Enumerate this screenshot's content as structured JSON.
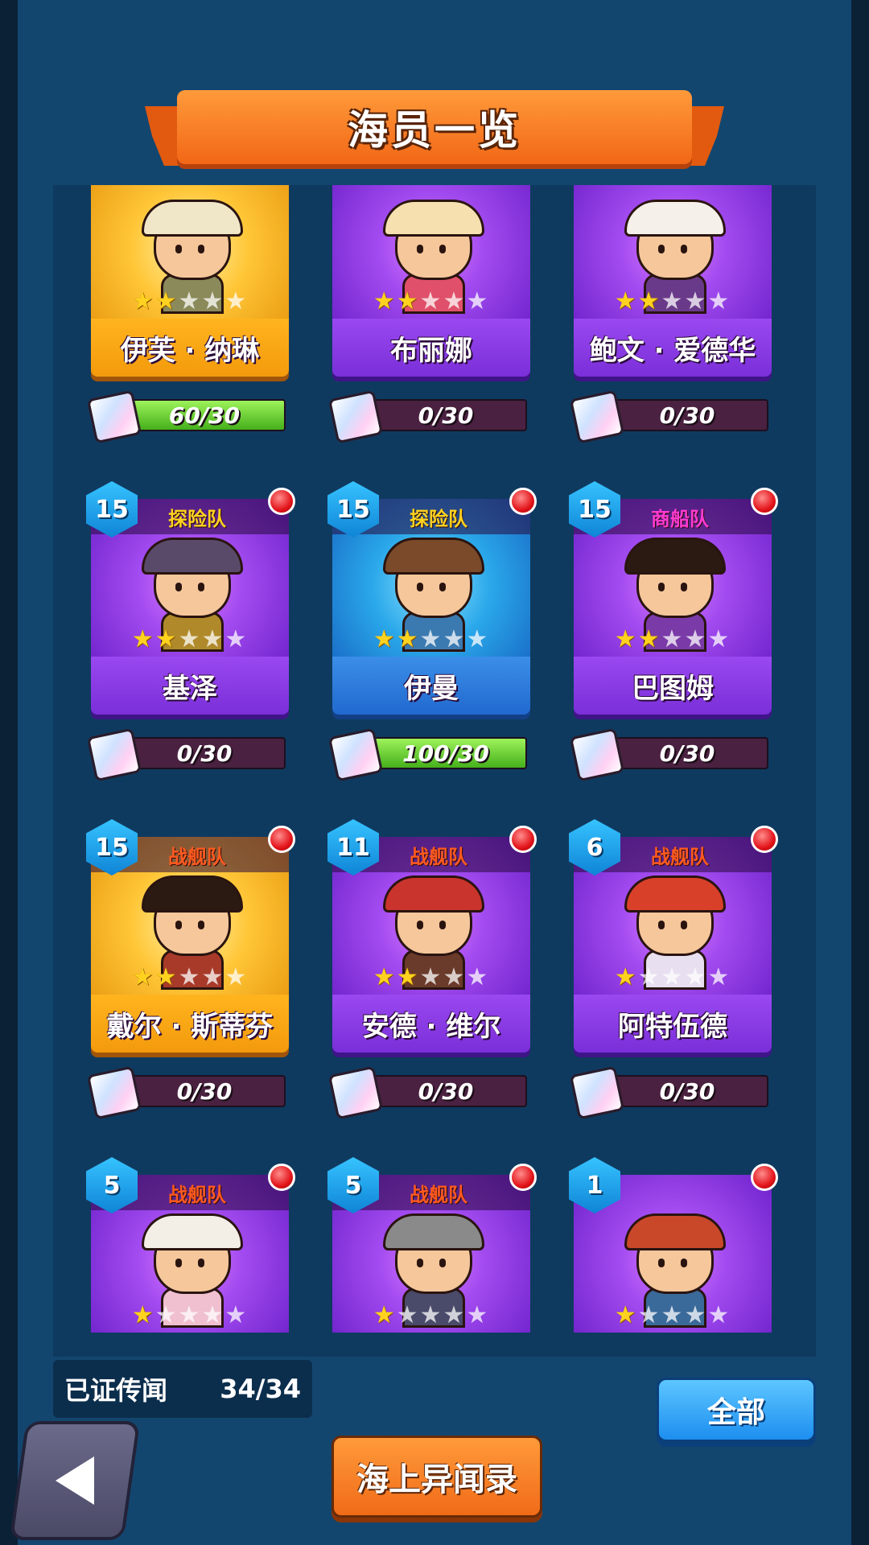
{
  "title": "海员一览",
  "colors": {
    "gold_card": "#ffc637",
    "purple_card": "#a24bf0",
    "blue_card": "#2aa8ea",
    "team_orange": "#ff5a1f",
    "team_yellow": "#ffd21f",
    "team_pink": "#ff3bd1",
    "progress_fill": "#45b01b"
  },
  "crew": [
    {
      "name": "伊芙 · 纳琳",
      "rarity": "gold",
      "level": "",
      "team": "",
      "stars": 2,
      "progress": "60/30",
      "progress_fraction": 1.0,
      "red_dot": false
    },
    {
      "name": "布丽娜",
      "rarity": "purple",
      "level": "",
      "team": "",
      "stars": 2,
      "progress": "0/30",
      "progress_fraction": 0,
      "red_dot": false
    },
    {
      "name": "鲍文 · 爱德华",
      "rarity": "purple",
      "level": "",
      "team": "",
      "stars": 2,
      "progress": "0/30",
      "progress_fraction": 0,
      "red_dot": false
    },
    {
      "name": "基泽",
      "rarity": "purple",
      "level": "15",
      "team": "探险队",
      "team_color": "#ffd21f",
      "stars": 2,
      "progress": "0/30",
      "progress_fraction": 0,
      "red_dot": true
    },
    {
      "name": "伊曼",
      "rarity": "blue",
      "level": "15",
      "team": "探险队",
      "team_color": "#ffd21f",
      "stars": 2,
      "progress": "100/30",
      "progress_fraction": 1.0,
      "red_dot": true
    },
    {
      "name": "巴图姆",
      "rarity": "purple",
      "level": "15",
      "team": "商船队",
      "team_color": "#ff3bd1",
      "stars": 2,
      "progress": "0/30",
      "progress_fraction": 0,
      "red_dot": true
    },
    {
      "name": "戴尔 · 斯蒂芬",
      "rarity": "gold",
      "level": "15",
      "team": "战舰队",
      "team_color": "#ff5a1f",
      "stars": 2,
      "progress": "0/30",
      "progress_fraction": 0,
      "red_dot": true
    },
    {
      "name": "安德 · 维尔",
      "rarity": "purple",
      "level": "11",
      "team": "战舰队",
      "team_color": "#ff5a1f",
      "stars": 2,
      "progress": "0/30",
      "progress_fraction": 0,
      "red_dot": true
    },
    {
      "name": "阿特伍德",
      "rarity": "purple",
      "level": "6",
      "team": "战舰队",
      "team_color": "#ff5a1f",
      "stars": 1,
      "progress": "0/30",
      "progress_fraction": 0,
      "red_dot": true
    },
    {
      "name": "",
      "rarity": "purple",
      "level": "5",
      "team": "战舰队",
      "team_color": "#ff5a1f",
      "stars": 1,
      "progress": "",
      "progress_fraction": 0,
      "red_dot": true
    },
    {
      "name": "",
      "rarity": "purple",
      "level": "5",
      "team": "战舰队",
      "team_color": "#ff5a1f",
      "stars": 1,
      "progress": "",
      "progress_fraction": 0,
      "red_dot": true
    },
    {
      "name": "",
      "rarity": "purple",
      "level": "1",
      "team": "",
      "team_color": "#ff5a1f",
      "stars": 1,
      "progress": "",
      "progress_fraction": 0,
      "red_dot": true
    }
  ],
  "footer": {
    "legend_label": "已证传闻",
    "legend_count": "34/34",
    "all_button": "全部",
    "rumor_button": "海上异闻录",
    "back_icon": "back-arrow-icon",
    "puzzle_icon": "puzzle-piece-icon"
  }
}
